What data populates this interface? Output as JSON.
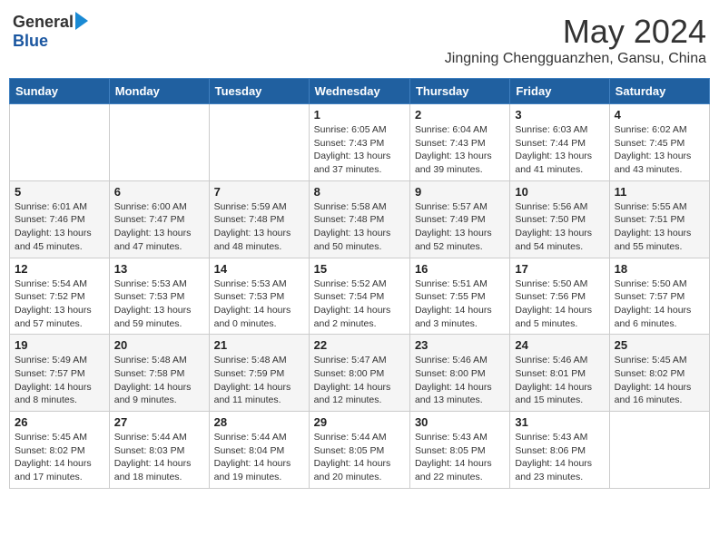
{
  "header": {
    "logo_general": "General",
    "logo_blue": "Blue",
    "month_title": "May 2024",
    "subtitle": "Jingning Chengguanzhen, Gansu, China"
  },
  "weekdays": [
    "Sunday",
    "Monday",
    "Tuesday",
    "Wednesday",
    "Thursday",
    "Friday",
    "Saturday"
  ],
  "weeks": [
    [
      {
        "day": "",
        "info": ""
      },
      {
        "day": "",
        "info": ""
      },
      {
        "day": "",
        "info": ""
      },
      {
        "day": "1",
        "info": "Sunrise: 6:05 AM\nSunset: 7:43 PM\nDaylight: 13 hours\nand 37 minutes."
      },
      {
        "day": "2",
        "info": "Sunrise: 6:04 AM\nSunset: 7:43 PM\nDaylight: 13 hours\nand 39 minutes."
      },
      {
        "day": "3",
        "info": "Sunrise: 6:03 AM\nSunset: 7:44 PM\nDaylight: 13 hours\nand 41 minutes."
      },
      {
        "day": "4",
        "info": "Sunrise: 6:02 AM\nSunset: 7:45 PM\nDaylight: 13 hours\nand 43 minutes."
      }
    ],
    [
      {
        "day": "5",
        "info": "Sunrise: 6:01 AM\nSunset: 7:46 PM\nDaylight: 13 hours\nand 45 minutes."
      },
      {
        "day": "6",
        "info": "Sunrise: 6:00 AM\nSunset: 7:47 PM\nDaylight: 13 hours\nand 47 minutes."
      },
      {
        "day": "7",
        "info": "Sunrise: 5:59 AM\nSunset: 7:48 PM\nDaylight: 13 hours\nand 48 minutes."
      },
      {
        "day": "8",
        "info": "Sunrise: 5:58 AM\nSunset: 7:48 PM\nDaylight: 13 hours\nand 50 minutes."
      },
      {
        "day": "9",
        "info": "Sunrise: 5:57 AM\nSunset: 7:49 PM\nDaylight: 13 hours\nand 52 minutes."
      },
      {
        "day": "10",
        "info": "Sunrise: 5:56 AM\nSunset: 7:50 PM\nDaylight: 13 hours\nand 54 minutes."
      },
      {
        "day": "11",
        "info": "Sunrise: 5:55 AM\nSunset: 7:51 PM\nDaylight: 13 hours\nand 55 minutes."
      }
    ],
    [
      {
        "day": "12",
        "info": "Sunrise: 5:54 AM\nSunset: 7:52 PM\nDaylight: 13 hours\nand 57 minutes."
      },
      {
        "day": "13",
        "info": "Sunrise: 5:53 AM\nSunset: 7:53 PM\nDaylight: 13 hours\nand 59 minutes."
      },
      {
        "day": "14",
        "info": "Sunrise: 5:53 AM\nSunset: 7:53 PM\nDaylight: 14 hours\nand 0 minutes."
      },
      {
        "day": "15",
        "info": "Sunrise: 5:52 AM\nSunset: 7:54 PM\nDaylight: 14 hours\nand 2 minutes."
      },
      {
        "day": "16",
        "info": "Sunrise: 5:51 AM\nSunset: 7:55 PM\nDaylight: 14 hours\nand 3 minutes."
      },
      {
        "day": "17",
        "info": "Sunrise: 5:50 AM\nSunset: 7:56 PM\nDaylight: 14 hours\nand 5 minutes."
      },
      {
        "day": "18",
        "info": "Sunrise: 5:50 AM\nSunset: 7:57 PM\nDaylight: 14 hours\nand 6 minutes."
      }
    ],
    [
      {
        "day": "19",
        "info": "Sunrise: 5:49 AM\nSunset: 7:57 PM\nDaylight: 14 hours\nand 8 minutes."
      },
      {
        "day": "20",
        "info": "Sunrise: 5:48 AM\nSunset: 7:58 PM\nDaylight: 14 hours\nand 9 minutes."
      },
      {
        "day": "21",
        "info": "Sunrise: 5:48 AM\nSunset: 7:59 PM\nDaylight: 14 hours\nand 11 minutes."
      },
      {
        "day": "22",
        "info": "Sunrise: 5:47 AM\nSunset: 8:00 PM\nDaylight: 14 hours\nand 12 minutes."
      },
      {
        "day": "23",
        "info": "Sunrise: 5:46 AM\nSunset: 8:00 PM\nDaylight: 14 hours\nand 13 minutes."
      },
      {
        "day": "24",
        "info": "Sunrise: 5:46 AM\nSunset: 8:01 PM\nDaylight: 14 hours\nand 15 minutes."
      },
      {
        "day": "25",
        "info": "Sunrise: 5:45 AM\nSunset: 8:02 PM\nDaylight: 14 hours\nand 16 minutes."
      }
    ],
    [
      {
        "day": "26",
        "info": "Sunrise: 5:45 AM\nSunset: 8:02 PM\nDaylight: 14 hours\nand 17 minutes."
      },
      {
        "day": "27",
        "info": "Sunrise: 5:44 AM\nSunset: 8:03 PM\nDaylight: 14 hours\nand 18 minutes."
      },
      {
        "day": "28",
        "info": "Sunrise: 5:44 AM\nSunset: 8:04 PM\nDaylight: 14 hours\nand 19 minutes."
      },
      {
        "day": "29",
        "info": "Sunrise: 5:44 AM\nSunset: 8:05 PM\nDaylight: 14 hours\nand 20 minutes."
      },
      {
        "day": "30",
        "info": "Sunrise: 5:43 AM\nSunset: 8:05 PM\nDaylight: 14 hours\nand 22 minutes."
      },
      {
        "day": "31",
        "info": "Sunrise: 5:43 AM\nSunset: 8:06 PM\nDaylight: 14 hours\nand 23 minutes."
      },
      {
        "day": "",
        "info": ""
      }
    ]
  ]
}
